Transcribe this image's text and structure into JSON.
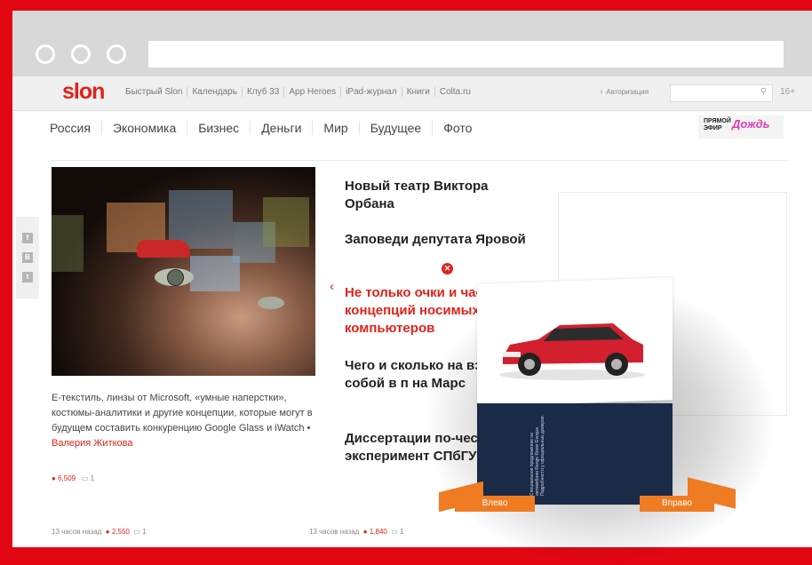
{
  "site": {
    "logo": "slon",
    "top_links": [
      "Быстрый Slon",
      "Календарь",
      "Клуб 33",
      "App Heroes",
      "iPad-журнал",
      "Книги",
      "Colta.ru"
    ],
    "auth_label": "Авторизация",
    "age_badge": "16+",
    "nav": [
      "Россия",
      "Экономика",
      "Бизнес",
      "Деньги",
      "Мир",
      "Будущее",
      "Фото"
    ],
    "live": {
      "line1": "ПРЯМОЙ",
      "line2": "ЭФИР",
      "brand": "Дождь"
    }
  },
  "share_icons": [
    "facebook-icon",
    "vk-icon",
    "twitter-icon"
  ],
  "lead": {
    "caption": "E-текстиль, линзы от Microsoft, «умные наперстки», костюмы-аналитики и другие концепции, которые могут в будущем составить конкуренцию Google Glass и iWatch",
    "bullet": "•",
    "author": "Валерия Житкова",
    "views": "6,509",
    "comments": "1"
  },
  "headlines": [
    {
      "text": "Новый театр Виктора Орбана"
    },
    {
      "text": "Заповеди депутата Яровой"
    },
    {
      "text": "Не только очки и часы: 6 концепций носимых компьютеров"
    },
    {
      "text": "Чего и сколько на взять с собой в п на Марс"
    },
    {
      "text": "Диссертации по-честному: эксперимент СПбГУ"
    }
  ],
  "footer_stats": [
    {
      "time": "13 часов назад",
      "views": "2,550",
      "comments": "1"
    },
    {
      "time": "13 часов назад",
      "views": "1,840",
      "comments": "1"
    }
  ],
  "ad": {
    "left_button": "Влево",
    "right_button": "Вправо",
    "car_color": "#d31f2e",
    "back_text": "Специальное предложение на автомобили Range Rover Evoque. Подробности у официальных дилеров."
  },
  "colors": {
    "accent": "#e2231a",
    "frame": "#e30613",
    "ad_orange": "#ef7b22",
    "ad_navy": "#1b2a46"
  }
}
